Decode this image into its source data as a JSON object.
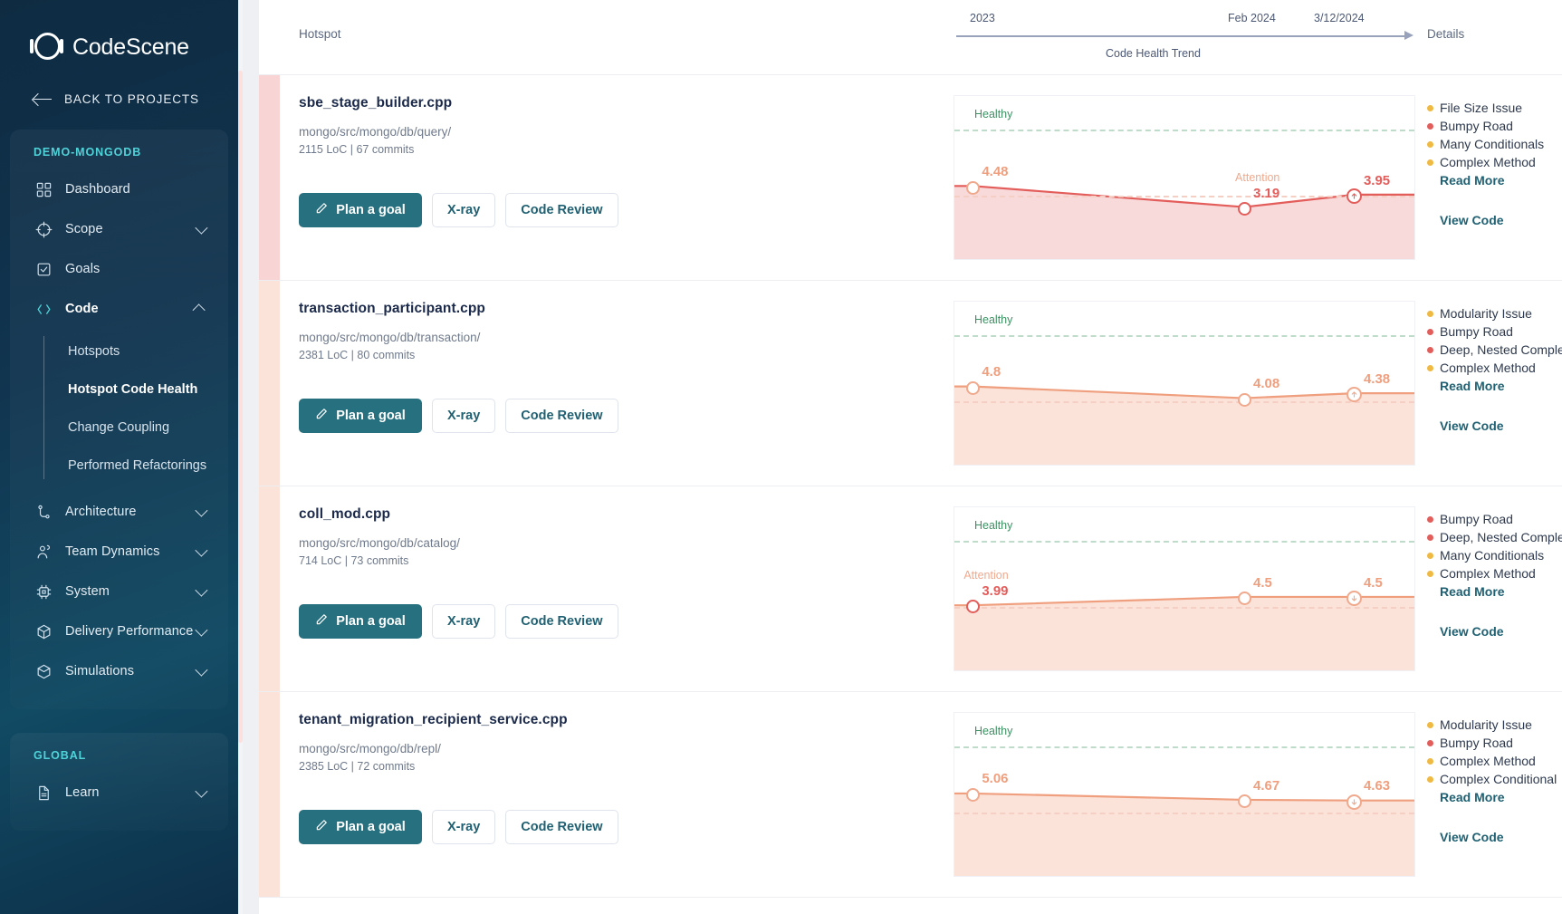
{
  "brand": {
    "name": "CodeScene",
    "logo_icon": "codescene-logo-icon"
  },
  "sidebar": {
    "back_label": "BACK TO PROJECTS",
    "back_icon": "arrow-left-icon",
    "project_title": "DEMO-MONGODB",
    "global_title": "GLOBAL",
    "items": [
      {
        "label": "Dashboard",
        "icon": "grid-icon",
        "expandable": false
      },
      {
        "label": "Scope",
        "icon": "target-icon",
        "expandable": true,
        "chevron": "down"
      },
      {
        "label": "Goals",
        "icon": "checkbox-icon",
        "expandable": false
      },
      {
        "label": "Code",
        "icon": "code-brackets-icon",
        "expandable": true,
        "chevron": "up",
        "active": true
      },
      {
        "label": "Architecture",
        "icon": "branch-icon",
        "expandable": true,
        "chevron": "down"
      },
      {
        "label": "Team Dynamics",
        "icon": "people-icon",
        "expandable": true,
        "chevron": "down"
      },
      {
        "label": "System",
        "icon": "chip-icon",
        "expandable": true,
        "chevron": "down"
      },
      {
        "label": "Delivery Performance",
        "icon": "box-icon",
        "expandable": true,
        "chevron": "down"
      },
      {
        "label": "Simulations",
        "icon": "cube-icon",
        "expandable": true,
        "chevron": "down"
      }
    ],
    "code_subitems": [
      {
        "label": "Hotspots",
        "active": false
      },
      {
        "label": "Hotspot Code Health",
        "active": true
      },
      {
        "label": "Change Coupling",
        "active": false
      },
      {
        "label": "Performed Refactorings",
        "active": false
      }
    ],
    "global_items": [
      {
        "label": "Learn",
        "icon": "document-icon",
        "expandable": true,
        "chevron": "down"
      }
    ]
  },
  "header": {
    "hotspot_col": "Hotspot",
    "details_col": "Details",
    "axis_caption": "Code Health Trend",
    "axis_ticks": [
      {
        "label": "2023",
        "pos_pct": 3
      },
      {
        "label": "Feb 2024",
        "pos_pct": 60
      },
      {
        "label": "3/12/2024",
        "pos_pct": 79
      }
    ]
  },
  "labels": {
    "plan_goal": "Plan a goal",
    "xray": "X-ray",
    "code_review": "Code Review",
    "read_more": "Read More",
    "view_code": "View Code",
    "healthy": "Healthy",
    "attention": "Attention"
  },
  "colors": {
    "primary": "#27707f",
    "link": "#1f6173",
    "red": "#e35d5b",
    "orange": "#ef9f7e",
    "yellow": "#f0b942",
    "healthy_green": "#3d9163",
    "attention_orange": "#f0a98d",
    "strip_red": "#f7d6d6",
    "strip_peach": "#fbe3da"
  },
  "rows": [
    {
      "file": "sbe_stage_builder.cpp",
      "path": "mongo/src/mongo/db/query/",
      "meta": "2115 LoC | 67 commits",
      "strip_color": "#f8d4d4",
      "chart_data": {
        "type": "line",
        "title": "Code Health Trend",
        "series_color": "#e35d5b",
        "fill_color": "#f8dada",
        "healthy_threshold": 8,
        "attention_threshold": 4,
        "ylim": [
          0,
          10
        ],
        "points": [
          {
            "x_pct": 4,
            "value": 4.48,
            "label": "4.48",
            "label_color": "#ef9f7e",
            "marker_color": "#f0a98d",
            "trend": "none"
          },
          {
            "x_pct": 63,
            "value": 3.19,
            "label": "3.19",
            "label_color": "#e35d5b",
            "marker_color": "#e35d5b",
            "trend": "none",
            "band": "Attention"
          },
          {
            "x_pct": 87,
            "value": 3.95,
            "label": "3.95",
            "label_color": "#e35d5b",
            "marker_color": "#e35d5b",
            "trend": "up"
          }
        ]
      },
      "issues": [
        {
          "text": "File Size Issue",
          "color": "#f0b942"
        },
        {
          "text": "Bumpy Road",
          "color": "#e35d5b"
        },
        {
          "text": "Many Conditionals",
          "color": "#f0b942"
        },
        {
          "text": "Complex Method",
          "color": "#f0b942"
        }
      ]
    },
    {
      "file": "transaction_participant.cpp",
      "path": "mongo/src/mongo/db/transaction/",
      "meta": "2381 LoC | 80 commits",
      "strip_color": "#fbe3da",
      "chart_data": {
        "type": "line",
        "title": "Code Health Trend",
        "series_color": "#ef9f7e",
        "fill_color": "#fbe3da",
        "healthy_threshold": 8,
        "attention_threshold": 4,
        "ylim": [
          0,
          10
        ],
        "points": [
          {
            "x_pct": 4,
            "value": 4.8,
            "label": "4.8",
            "label_color": "#ef9f7e",
            "marker_color": "#f0a98d",
            "trend": "none"
          },
          {
            "x_pct": 63,
            "value": 4.08,
            "label": "4.08",
            "label_color": "#ef9f7e",
            "marker_color": "#f0a98d",
            "trend": "none"
          },
          {
            "x_pct": 87,
            "value": 4.38,
            "label": "4.38",
            "label_color": "#ef9f7e",
            "marker_color": "#f0a98d",
            "trend": "up"
          }
        ]
      },
      "issues": [
        {
          "text": "Modularity Issue",
          "color": "#f0b942"
        },
        {
          "text": "Bumpy Road",
          "color": "#e35d5b"
        },
        {
          "text": "Deep, Nested Complexity",
          "color": "#e35d5b"
        },
        {
          "text": "Complex Method",
          "color": "#f0b942"
        }
      ]
    },
    {
      "file": "coll_mod.cpp",
      "path": "mongo/src/mongo/db/catalog/",
      "meta": "714 LoC | 73 commits",
      "strip_color": "#fbe3da",
      "chart_data": {
        "type": "line",
        "title": "Code Health Trend",
        "series_color": "#ef9f7e",
        "fill_color": "#fbe3da",
        "healthy_threshold": 8,
        "attention_threshold": 4,
        "ylim": [
          0,
          10
        ],
        "points": [
          {
            "x_pct": 4,
            "value": 3.99,
            "label": "3.99",
            "label_color": "#e35d5b",
            "marker_color": "#e35d5b",
            "trend": "none",
            "band": "Attention"
          },
          {
            "x_pct": 63,
            "value": 4.5,
            "label": "4.5",
            "label_color": "#ef9f7e",
            "marker_color": "#f0a98d",
            "trend": "none"
          },
          {
            "x_pct": 87,
            "value": 4.5,
            "label": "4.5",
            "label_color": "#ef9f7e",
            "marker_color": "#f0a98d",
            "trend": "down"
          }
        ]
      },
      "issues": [
        {
          "text": "Bumpy Road",
          "color": "#e35d5b"
        },
        {
          "text": "Deep, Nested Complexity",
          "color": "#e35d5b"
        },
        {
          "text": "Many Conditionals",
          "color": "#f0b942"
        },
        {
          "text": "Complex Method",
          "color": "#f0b942"
        }
      ]
    },
    {
      "file": "tenant_migration_recipient_service.cpp",
      "path": "mongo/src/mongo/db/repl/",
      "meta": "2385 LoC | 72 commits",
      "strip_color": "#fbe3da",
      "chart_data": {
        "type": "line",
        "title": "Code Health Trend",
        "series_color": "#ef9f7e",
        "fill_color": "#fbe3da",
        "healthy_threshold": 8,
        "attention_threshold": 4,
        "ylim": [
          0,
          10
        ],
        "points": [
          {
            "x_pct": 4,
            "value": 5.06,
            "label": "5.06",
            "label_color": "#ef9f7e",
            "marker_color": "#f0a98d",
            "trend": "none"
          },
          {
            "x_pct": 63,
            "value": 4.67,
            "label": "4.67",
            "label_color": "#ef9f7e",
            "marker_color": "#f0a98d",
            "trend": "none"
          },
          {
            "x_pct": 87,
            "value": 4.63,
            "label": "4.63",
            "label_color": "#ef9f7e",
            "marker_color": "#f0a98d",
            "trend": "down"
          }
        ]
      },
      "issues": [
        {
          "text": "Modularity Issue",
          "color": "#f0b942"
        },
        {
          "text": "Bumpy Road",
          "color": "#e35d5b"
        },
        {
          "text": "Complex Method",
          "color": "#f0b942"
        },
        {
          "text": "Complex Conditional",
          "color": "#f0b942"
        }
      ]
    }
  ]
}
